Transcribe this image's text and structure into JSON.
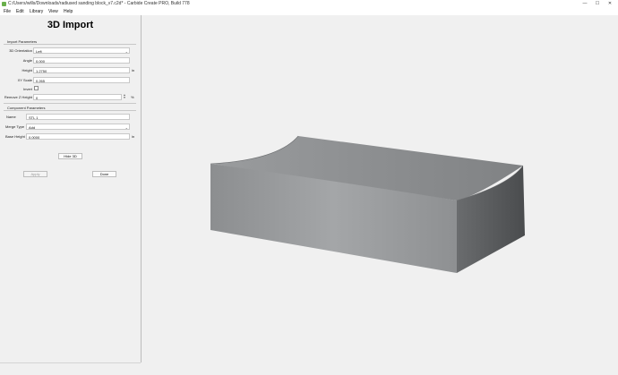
{
  "window": {
    "title": "C:/Users/wills/Downloads/radiused sanding block_v7.c2d* - Carbide Create PRO, Build 778",
    "controls": [
      "—",
      "☐",
      "✕"
    ]
  },
  "menu": {
    "items": [
      "File",
      "Edit",
      "Library",
      "View",
      "Help"
    ]
  },
  "panel": {
    "title": "3D Import",
    "import_section": "Import Parameters",
    "orientation_label": "3D Orientation",
    "orientation_value": "Left",
    "angle_label": "Angle",
    "angle_value": "0.000",
    "height_label": "Height",
    "height_value": "1.2750",
    "height_unit": "in",
    "xy_scale_label": "XY Scale",
    "xy_scale_value": "0.265",
    "invert_label": "Invert",
    "invert_checked": false,
    "remove_z_label": "Remove Z Height",
    "remove_z_value": "0",
    "remove_z_unit": "%",
    "component_section": "Component Parameters",
    "name_label": "Name",
    "name_value": "STL 1",
    "merge_label": "Merge Type",
    "merge_value": "Add",
    "base_height_label": "Base Height",
    "base_height_value": "0.0000",
    "base_height_unit": "in",
    "hide3d_button": "Hide 3D",
    "apply_button": "Apply",
    "done_button": "Done"
  },
  "colors": {
    "top_face": "#8e9092",
    "front_face": "#9a9c9e",
    "side_face": "#5e6062",
    "background": "#f0f0f0",
    "accent": "#6ab04c"
  }
}
